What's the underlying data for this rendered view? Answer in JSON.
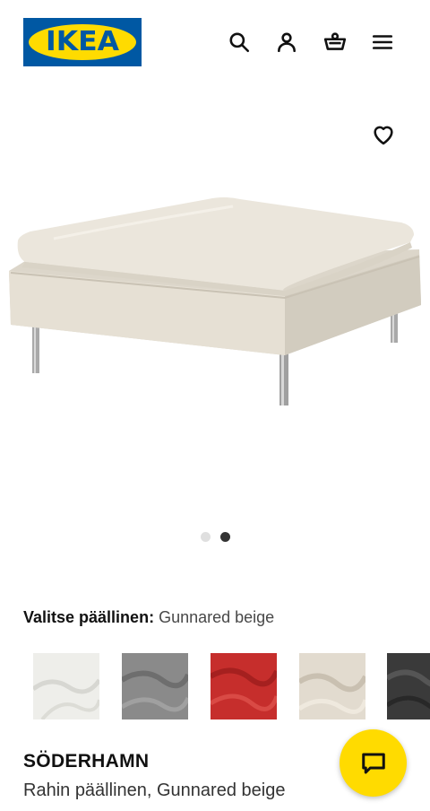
{
  "header": {
    "logo_text": "IKEA",
    "icons": [
      "search-icon",
      "account-icon",
      "cart-icon",
      "menu-icon"
    ]
  },
  "gallery": {
    "current_index": 2,
    "total_images": 2
  },
  "cover": {
    "label": "Valitse päällinen:",
    "selected": "Gunnared beige",
    "swatch_colors": [
      "#eeeeea",
      "#8a8a8a",
      "#c62e2c",
      "#e2dbcf",
      "#3a3a3a"
    ]
  },
  "product": {
    "name": "SÖDERHAMN",
    "description": "Rahin päällinen, Gunnared beige"
  },
  "colors": {
    "brand_blue": "#0058a3",
    "brand_yellow": "#ffdb00"
  }
}
